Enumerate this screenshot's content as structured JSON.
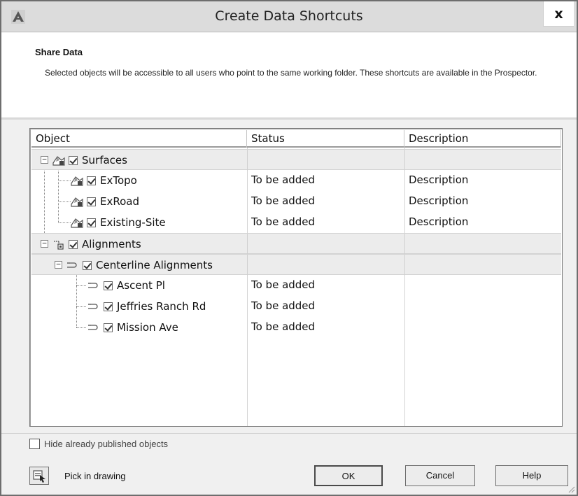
{
  "window": {
    "title": "Create Data Shortcuts",
    "close_label": "x",
    "app_icon": "autocad-icon"
  },
  "header": {
    "title": "Share Data",
    "description": "Selected objects will be accessible to all users who point to the same working folder. These shortcuts are available in the Prospector."
  },
  "table": {
    "columns": [
      "Object",
      "Status",
      "Description"
    ],
    "rows": [
      {
        "label": "Surfaces",
        "status": "",
        "description": "",
        "kind": "group",
        "icon": "surface-icon",
        "checked": true
      },
      {
        "label": "ExTopo",
        "status": "To be added",
        "description": "Description",
        "kind": "item",
        "icon": "surface-icon",
        "checked": true
      },
      {
        "label": "ExRoad",
        "status": "To be added",
        "description": "Description",
        "kind": "item",
        "icon": "surface-icon",
        "checked": true
      },
      {
        "label": "Existing-Site",
        "status": "To be added",
        "description": "Description",
        "kind": "item",
        "icon": "surface-icon",
        "checked": true
      },
      {
        "label": "Alignments",
        "status": "",
        "description": "",
        "kind": "group",
        "icon": "alignment-group-icon",
        "checked": true
      },
      {
        "label": "Centerline Alignments",
        "status": "",
        "description": "",
        "kind": "group",
        "icon": "alignment-icon",
        "checked": true
      },
      {
        "label": "Ascent Pl",
        "status": "To be added",
        "description": "",
        "kind": "item",
        "icon": "alignment-icon",
        "checked": true
      },
      {
        "label": "Jeffries Ranch Rd",
        "status": "To be added",
        "description": "",
        "kind": "item",
        "icon": "alignment-icon",
        "checked": true
      },
      {
        "label": "Mission Ave",
        "status": "To be added",
        "description": "",
        "kind": "item",
        "icon": "alignment-icon",
        "checked": true
      }
    ]
  },
  "options": {
    "hide_published_label": "Hide already published objects",
    "hide_published_checked": false
  },
  "footer": {
    "pick_label": "Pick in drawing",
    "pick_icon": "pick-in-drawing-icon",
    "ok_label": "OK",
    "cancel_label": "Cancel",
    "help_label": "Help"
  }
}
